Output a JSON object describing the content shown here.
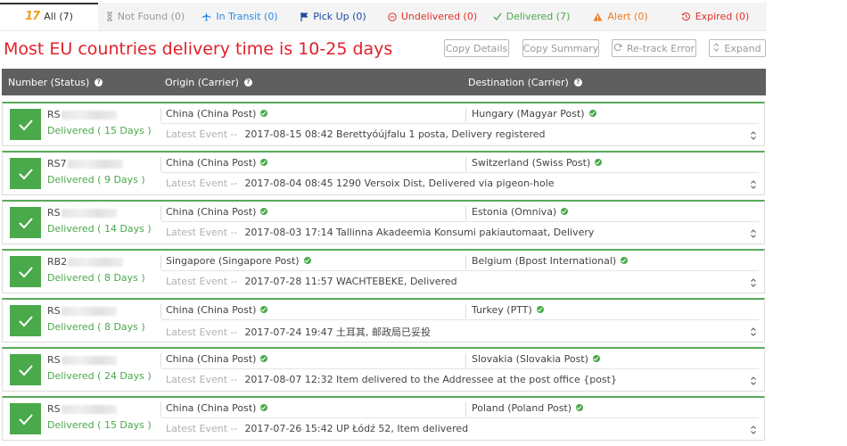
{
  "tabs": [
    {
      "name": "tab-all",
      "label": "All (7)",
      "icon": "17track-logo-icon",
      "color": "#333333",
      "active": true
    },
    {
      "name": "tab-not-found",
      "label": "Not Found (0)",
      "icon": "hourglass-icon",
      "color": "#999999"
    },
    {
      "name": "tab-in-transit",
      "label": "In Transit (0)",
      "icon": "plane-icon",
      "color": "#2b8be0"
    },
    {
      "name": "tab-pick-up",
      "label": "Pick Up (0)",
      "icon": "flag-icon",
      "color": "#1a4aa0"
    },
    {
      "name": "tab-undelivered",
      "label": "Undelivered (0)",
      "icon": "minus-circle-icon",
      "color": "#e0302a"
    },
    {
      "name": "tab-delivered",
      "label": "Delivered (7)",
      "icon": "check-icon",
      "color": "#4aa94a"
    },
    {
      "name": "tab-alert",
      "label": "Alert (0)",
      "icon": "warning-triangle-icon",
      "color": "#f07a20"
    },
    {
      "name": "tab-expired",
      "label": "Expired (0)",
      "icon": "history-icon",
      "color": "#e0302a"
    }
  ],
  "logo_text": "17",
  "headline": "Most EU countries delivery time is 10-25 days",
  "toolbar": {
    "copy_details": "Copy Details",
    "copy_summary": "Copy Summary",
    "retrack_error": "Re-track Error",
    "expand": "Expand"
  },
  "table_header": {
    "number": "Number (Status)",
    "origin": "Origin (Carrier)",
    "destination": "Destination (Carrier)"
  },
  "event_label": "Latest Event --",
  "rows": [
    {
      "number_prefix": "RS",
      "status": "Delivered ( 15 Days )",
      "origin": "China (China Post)",
      "destination": "Hungary (Magyar Post)",
      "event": "2017-08-15 08:42 Berettyóújfalu 1 posta, Delivery registered"
    },
    {
      "number_prefix": "RS7",
      "status": "Delivered ( 9 Days )",
      "origin": "China (China Post)",
      "destination": "Switzerland (Swiss Post)",
      "event": "2017-08-04 08:45 1290 Versoix Dist, Delivered via pigeon-hole"
    },
    {
      "number_prefix": "RS",
      "status": "Delivered ( 14 Days )",
      "origin": "China (China Post)",
      "destination": "Estonia (Omniva)",
      "event": "2017-08-03 17:14 Tallinna Akadeemia Konsumi pakiautomaat, Delivery"
    },
    {
      "number_prefix": "RB2",
      "status": "Delivered ( 8 Days )",
      "origin": "Singapore (Singapore Post)",
      "destination": "Belgium (Bpost International)",
      "event": "2017-07-28 11:57 WACHTEBEKE, Delivered"
    },
    {
      "number_prefix": "RS",
      "status": "Delivered ( 8 Days )",
      "origin": "China (China Post)",
      "destination": "Turkey (PTT)",
      "event": "2017-07-24 19:47 土耳其, 邮政局已妥投"
    },
    {
      "number_prefix": "RS",
      "status": "Delivered ( 24 Days )",
      "origin": "China (China Post)",
      "destination": "Slovakia (Slovakia Post)",
      "event": "2017-08-07 12:32 Item delivered to the Addressee at the post office {post}"
    },
    {
      "number_prefix": "RS",
      "status": "Delivered ( 15 Days )",
      "origin": "China (China Post)",
      "destination": "Poland (Poland Post)",
      "event": "2017-07-26 15:42 UP Łódź 52, Item delivered"
    }
  ]
}
